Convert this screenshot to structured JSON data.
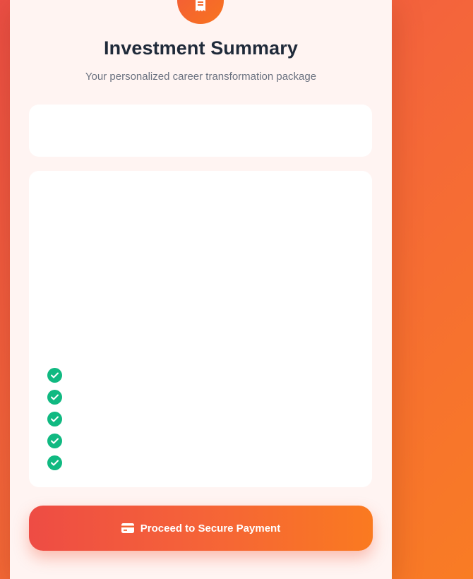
{
  "summary": {
    "title": "Investment Summary",
    "subtitle": "Your personalized career transformation package",
    "header_icon": "receipt-icon"
  },
  "top_panel": {
    "left_text": "",
    "right_text": ""
  },
  "package": {
    "name": "",
    "description": "",
    "price": "",
    "period": "",
    "features_title": "",
    "features": [
      {
        "icon": "check-circle-icon",
        "text": ""
      },
      {
        "icon": "check-circle-icon",
        "text": ""
      },
      {
        "icon": "check-circle-icon",
        "text": ""
      },
      {
        "icon": "check-circle-icon",
        "text": ""
      },
      {
        "icon": "check-circle-icon",
        "text": ""
      }
    ]
  },
  "payment": {
    "button_label": "Proceed to Secure Payment",
    "button_icon": "credit-card-icon"
  },
  "colors": {
    "accent_start": "#ee4c44",
    "accent_end": "#fa7a20",
    "check": "#10b981",
    "title": "#1f2a3a",
    "subtitle": "#6b7280",
    "card_bg": "#fff4f2"
  }
}
